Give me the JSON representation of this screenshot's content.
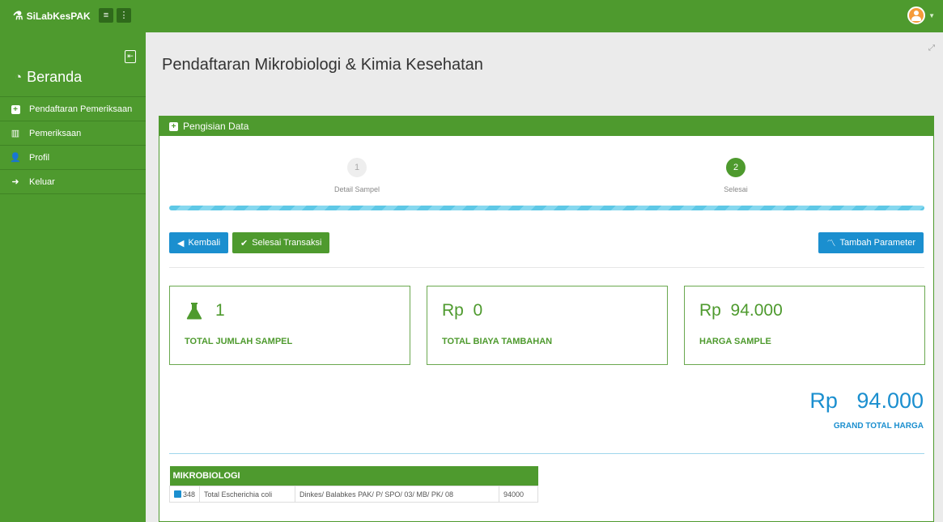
{
  "app": {
    "brand": "SiLabKesPAK"
  },
  "topbar": {
    "menu_icon": "hamburger-icon",
    "more_icon": "vertical-dots-icon",
    "user_icon": "user-avatar-icon"
  },
  "sidebar": {
    "title": "Beranda",
    "items": [
      {
        "label": "Pendaftaran Pemeriksaan",
        "icon": "plus-square-icon"
      },
      {
        "label": "Pemeriksaan",
        "icon": "columns-icon"
      },
      {
        "label": "Profil",
        "icon": "user-icon"
      },
      {
        "label": "Keluar",
        "icon": "logout-icon"
      }
    ]
  },
  "page": {
    "title": "Pendaftaran Mikrobiologi & Kimia Kesehatan"
  },
  "panel": {
    "heading": "Pengisian Data",
    "steps": [
      {
        "num": "1",
        "label": "Detail Sampel"
      },
      {
        "num": "2",
        "label": "Selesai"
      }
    ],
    "buttons": {
      "back": "Kembali",
      "finish": "Selesai Transaksi",
      "add_param": "Tambah Parameter"
    },
    "cards": [
      {
        "value": "1",
        "caption": "TOTAL JUMLAH SAMPEL"
      },
      {
        "currency": "Rp",
        "value": "0",
        "caption": "TOTAL BIAYA TAMBAHAN"
      },
      {
        "currency": "Rp",
        "value": "94.000",
        "caption": "HARGA SAMPLE"
      }
    ],
    "grand": {
      "currency": "Rp",
      "value": "94.000",
      "caption": "GRAND TOTAL HARGA"
    },
    "table": {
      "title": "MIKROBIOLOGI",
      "rows": [
        {
          "checked": true,
          "id": "348",
          "name": "Total Escherichia coli",
          "method": "Dinkes/ Balabkes PAK/ P/ SPO/ 03/ MB/ PK/ 08",
          "price": "94000"
        }
      ]
    }
  },
  "colors": {
    "primary_green": "#4e9a2e",
    "accent_blue": "#1b8fcf"
  }
}
